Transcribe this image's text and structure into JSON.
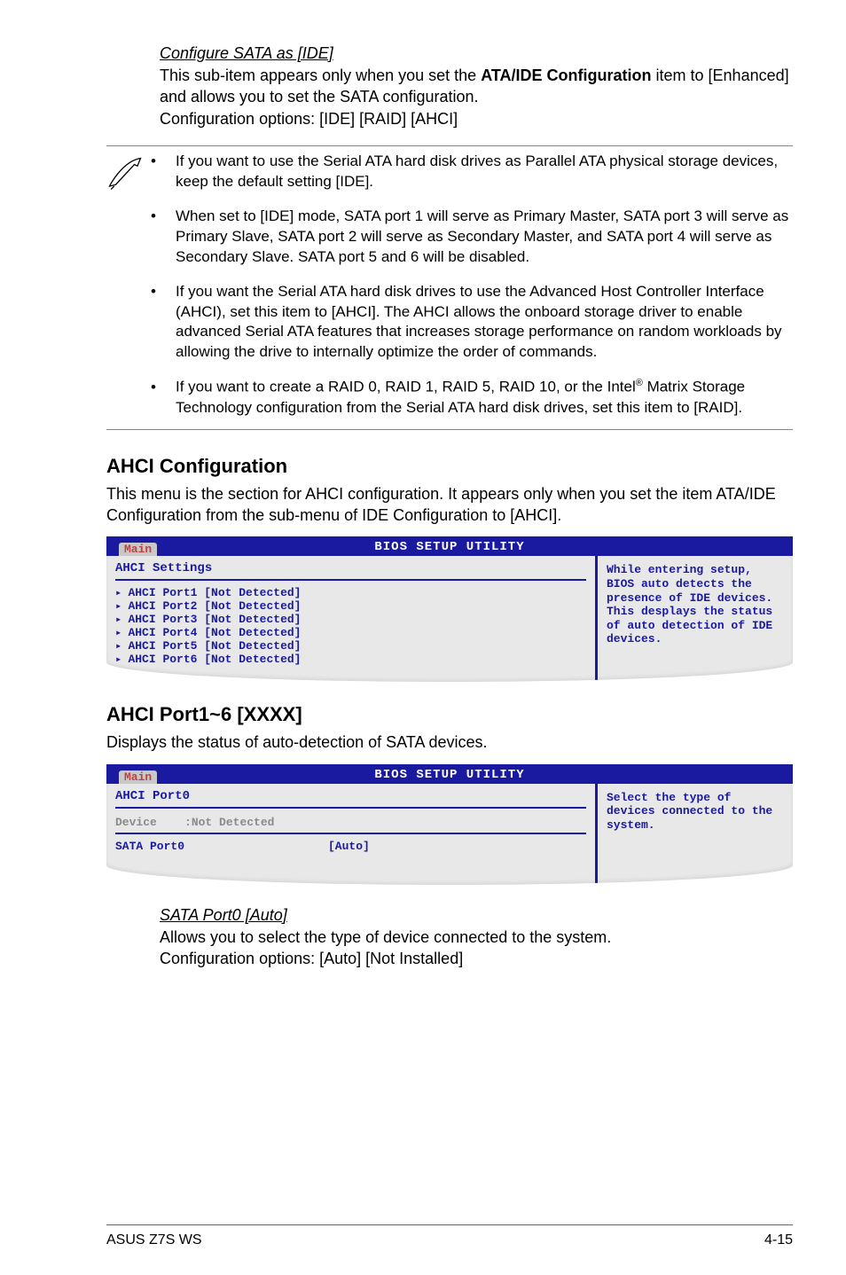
{
  "section_configure_sata": {
    "heading": "Configure SATA as [IDE]",
    "para_line1_a": "This sub-item appears only when you set the ",
    "para_line1_bold": "ATA/IDE Configuration",
    "para_line1_b": " item to [Enhanced] and allows you to set the SATA configuration.",
    "para_line2": "Configuration options: [IDE] [RAID] [AHCI]"
  },
  "notes": [
    "If you want to use the Serial ATA hard disk drives as Parallel ATA physical storage devices, keep the default setting [IDE].",
    "When set to [IDE] mode, SATA port 1 will serve as Primary Master, SATA port 3 will serve as Primary Slave, SATA port 2 will serve as Secondary Master, and SATA port 4 will serve as Secondary Slave. SATA port 5 and 6 will be disabled.",
    "If you want the Serial ATA hard disk drives to use the Advanced Host Controller Interface (AHCI), set this item to [AHCI]. The AHCI allows the onboard storage driver to enable advanced Serial ATA features that increases storage performance on random workloads by allowing the drive to internally optimize the order of commands."
  ],
  "note4": {
    "prefix": "If you want to create a RAID 0, RAID 1, RAID 5, RAID 10, or the Intel",
    "sup": "®",
    "suffix": " Matrix Storage Technology configuration from the Serial ATA hard disk drives, set this item to [RAID]."
  },
  "ahci_config": {
    "heading": "AHCI Configuration",
    "para": "This menu is the section for AHCI configuration. It appears only when you set the item ATA/IDE Configuration from the sub-menu of IDE Configuration to [AHCI]."
  },
  "bios1": {
    "title": "BIOS SETUP UTILITY",
    "tab": "Main",
    "panel_title": "AHCI Settings",
    "items": [
      "AHCI Port1 [Not Detected]",
      "AHCI Port2 [Not Detected]",
      "AHCI Port3 [Not Detected]",
      "AHCI Port4 [Not Detected]",
      "AHCI Port5 [Not Detected]",
      "AHCI Port6 [Not Detected]"
    ],
    "help": "While entering setup, BIOS auto detects the presence of IDE devices. This desplays the status of auto detection of IDE devices."
  },
  "ahci_port": {
    "heading": "AHCI Port1~6 [XXXX]",
    "para": "Displays the status of auto-detection of SATA devices."
  },
  "bios2": {
    "title": "BIOS SETUP UTILITY",
    "tab": "Main",
    "panel_title": "AHCI Port0",
    "device_label": "Device",
    "device_value": ":Not Detected",
    "sata_label": "SATA Port0",
    "sata_value": "[Auto]",
    "help": "Select the type of devices connected to the system."
  },
  "sata_port0": {
    "heading": "SATA Port0 [Auto]",
    "line1": "Allows you to select the type of device connected to the system.",
    "line2": "Configuration options: [Auto] [Not Installed]"
  },
  "footer": {
    "left": "ASUS Z7S WS",
    "right": "4-15"
  }
}
